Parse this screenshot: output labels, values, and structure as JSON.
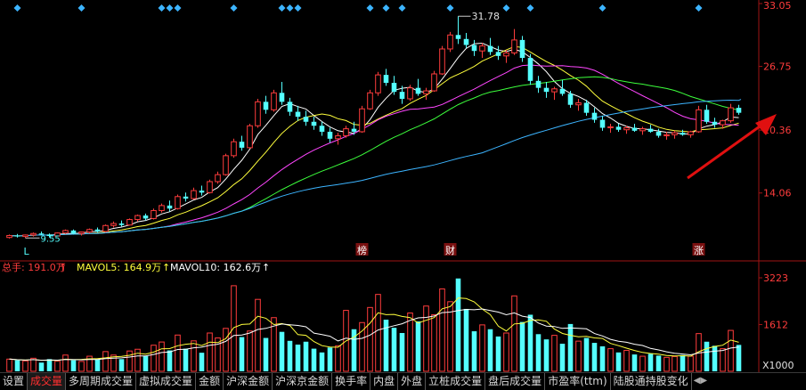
{
  "chart_data": [
    {
      "type": "candlestick",
      "price_axis": {
        "ticks": [
          "33.05",
          "26.75",
          "20.36",
          "14.06"
        ],
        "ylim": [
          7.7,
          33.05
        ]
      },
      "annotations": {
        "high_label": "31.78",
        "low_label": "9.55",
        "L_marker": "L",
        "markers": [
          "榜",
          "财",
          "涨"
        ]
      },
      "up_color": "#ff3c3c",
      "down_color": "#54ffff",
      "candles": [
        [
          9.6,
          9.9,
          9.5,
          9.8
        ],
        [
          9.8,
          9.95,
          9.6,
          9.7
        ],
        [
          9.7,
          9.9,
          9.55,
          9.85
        ],
        [
          9.85,
          10.1,
          9.7,
          10.0
        ],
        [
          10.0,
          10.2,
          9.8,
          9.9
        ],
        [
          9.9,
          10.0,
          9.6,
          9.75
        ],
        [
          9.75,
          10.1,
          9.7,
          10.05
        ],
        [
          10.05,
          10.4,
          9.95,
          10.3
        ],
        [
          10.3,
          10.4,
          9.9,
          10.0
        ],
        [
          10.0,
          10.2,
          9.8,
          10.15
        ],
        [
          10.15,
          10.5,
          10.0,
          10.4
        ],
        [
          10.4,
          10.6,
          10.1,
          10.2
        ],
        [
          10.2,
          10.9,
          10.1,
          10.8
        ],
        [
          10.8,
          11.2,
          10.6,
          11.0
        ],
        [
          11.0,
          11.3,
          10.7,
          10.85
        ],
        [
          10.85,
          11.5,
          10.8,
          11.4
        ],
        [
          11.4,
          11.9,
          11.2,
          11.8
        ],
        [
          11.8,
          12.0,
          11.3,
          11.5
        ],
        [
          11.5,
          12.5,
          11.4,
          12.3
        ],
        [
          12.3,
          13.0,
          12.1,
          12.8
        ],
        [
          12.8,
          13.3,
          12.2,
          12.5
        ],
        [
          12.5,
          13.9,
          12.4,
          13.7
        ],
        [
          13.7,
          14.1,
          13.2,
          13.5
        ],
        [
          13.5,
          14.6,
          13.4,
          14.3
        ],
        [
          14.3,
          14.8,
          13.8,
          14.1
        ],
        [
          14.1,
          15.4,
          14.0,
          15.2
        ],
        [
          15.2,
          16.2,
          15.0,
          15.9
        ],
        [
          15.9,
          18.0,
          15.8,
          17.8
        ],
        [
          17.8,
          19.5,
          17.6,
          19.2
        ],
        [
          19.2,
          19.8,
          18.3,
          18.6
        ],
        [
          18.6,
          21.0,
          18.5,
          20.8
        ],
        [
          20.8,
          23.5,
          20.6,
          23.2
        ],
        [
          23.2,
          23.8,
          22.0,
          22.4
        ],
        [
          22.4,
          24.4,
          22.2,
          24.1
        ],
        [
          24.1,
          25.2,
          22.9,
          23.2
        ],
        [
          23.2,
          23.6,
          21.8,
          22.2
        ],
        [
          22.2,
          22.8,
          21.3,
          21.7
        ],
        [
          21.7,
          22.3,
          20.8,
          21.2
        ],
        [
          21.2,
          21.7,
          20.4,
          20.8
        ],
        [
          20.8,
          21.2,
          19.8,
          20.2
        ],
        [
          20.2,
          20.6,
          19.1,
          19.5
        ],
        [
          19.5,
          20.1,
          18.9,
          19.8
        ],
        [
          19.8,
          20.8,
          19.6,
          20.5
        ],
        [
          20.5,
          21.2,
          19.9,
          20.2
        ],
        [
          20.2,
          22.8,
          20.1,
          22.5
        ],
        [
          22.5,
          24.4,
          22.4,
          24.1
        ],
        [
          24.1,
          26.2,
          23.8,
          25.9
        ],
        [
          25.9,
          26.5,
          24.8,
          25.1
        ],
        [
          25.1,
          25.8,
          23.9,
          24.2
        ],
        [
          24.2,
          24.8,
          23.0,
          23.5
        ],
        [
          23.5,
          24.9,
          23.3,
          24.6
        ],
        [
          24.6,
          25.5,
          23.8,
          24.0
        ],
        [
          24.0,
          24.6,
          23.4,
          24.3
        ],
        [
          24.3,
          26.3,
          24.2,
          26.0
        ],
        [
          26.0,
          28.8,
          25.9,
          28.5
        ],
        [
          28.5,
          30.2,
          28.2,
          29.9
        ],
        [
          29.9,
          31.78,
          29.0,
          29.5
        ],
        [
          29.5,
          30.1,
          28.6,
          28.9
        ],
        [
          28.9,
          29.4,
          27.8,
          28.3
        ],
        [
          28.3,
          29.1,
          27.6,
          28.8
        ],
        [
          28.8,
          29.6,
          27.9,
          28.2
        ],
        [
          28.2,
          28.8,
          27.4,
          27.8
        ],
        [
          27.8,
          28.4,
          27.1,
          28.1
        ],
        [
          28.1,
          30.5,
          27.9,
          29.4
        ],
        [
          29.4,
          29.8,
          27.2,
          27.6
        ],
        [
          27.6,
          28.0,
          24.9,
          25.3
        ],
        [
          25.3,
          25.8,
          24.1,
          24.6
        ],
        [
          24.6,
          25.2,
          23.6,
          24.2
        ],
        [
          24.2,
          24.7,
          23.4,
          24.5
        ],
        [
          24.5,
          25.4,
          23.8,
          24.0
        ],
        [
          24.0,
          24.3,
          22.6,
          22.9
        ],
        [
          22.9,
          23.5,
          22.3,
          23.1
        ],
        [
          23.1,
          23.4,
          21.8,
          22.1
        ],
        [
          22.1,
          22.6,
          21.1,
          21.4
        ],
        [
          21.4,
          21.8,
          20.3,
          20.6
        ],
        [
          20.6,
          21.0,
          20.1,
          20.7
        ],
        [
          20.7,
          21.0,
          20.2,
          20.4
        ],
        [
          20.4,
          20.8,
          20.0,
          20.6
        ],
        [
          20.6,
          21.0,
          20.2,
          20.3
        ],
        [
          20.3,
          20.7,
          19.9,
          20.5
        ],
        [
          20.5,
          20.9,
          20.1,
          20.2
        ],
        [
          20.2,
          20.5,
          19.6,
          19.8
        ],
        [
          19.8,
          20.2,
          19.4,
          19.9
        ],
        [
          19.9,
          20.3,
          19.5,
          20.1
        ],
        [
          20.1,
          20.4,
          19.8,
          19.9
        ],
        [
          19.9,
          20.3,
          19.6,
          20.2
        ],
        [
          20.2,
          22.8,
          20.1,
          22.4
        ],
        [
          22.4,
          22.9,
          21.0,
          21.2
        ],
        [
          21.2,
          21.6,
          20.6,
          20.9
        ],
        [
          20.9,
          21.4,
          20.5,
          21.3
        ],
        [
          21.3,
          23.0,
          21.1,
          22.6
        ],
        [
          22.6,
          22.9,
          21.9,
          22.1
        ]
      ]
    },
    {
      "type": "bar",
      "legend": {
        "total_label": "总手: 191.0万",
        "mavol5_label": "MAVOL5: 164.9万",
        "mavol10_label": "MAVOL10: 162.6万"
      },
      "legend_colors": {
        "total": "#ff3c3c",
        "mavol5": "#ffff3c",
        "mavol10": "#ffffff"
      },
      "axis": {
        "ticks": [
          "3223",
          "1612"
        ],
        "unit": "X1000",
        "ylim": [
          0,
          3223
        ]
      },
      "values": [
        420,
        380,
        360,
        450,
        300,
        420,
        350,
        560,
        380,
        340,
        520,
        400,
        680,
        560,
        420,
        700,
        760,
        520,
        900,
        1010,
        720,
        1250,
        780,
        1050,
        640,
        1320,
        1150,
        1480,
        2950,
        1180,
        1390,
        2480,
        1150,
        1850,
        1360,
        1050,
        920,
        1020,
        780,
        650,
        820,
        880,
        2100,
        1450,
        1680,
        2200,
        2650,
        1780,
        1500,
        1320,
        2010,
        1720,
        2250,
        1950,
        2840,
        2400,
        3200,
        2150,
        1380,
        1600,
        1450,
        1200,
        1320,
        2600,
        1700,
        1950,
        1280,
        1100,
        1240,
        950,
        1630,
        1040,
        1150,
        980,
        860,
        780,
        650,
        720,
        580,
        520,
        600,
        540,
        480,
        510,
        560,
        520,
        1300,
        1020,
        880,
        780,
        1410,
        910
      ]
    }
  ],
  "tabs": [
    "设置",
    "成交量",
    "多周期成交量",
    "虚拟成交量",
    "金额",
    "沪深金额",
    "沪深京金额",
    "换手率",
    "内盘",
    "外盘",
    "立桩成交量",
    "盘后成交量",
    "市盈率(ttm)",
    "陆股通持股变化"
  ],
  "active_tab": "成交量",
  "tab_scroll_icons": [
    "triangle-left-icon",
    "triangle-right-icon"
  ]
}
